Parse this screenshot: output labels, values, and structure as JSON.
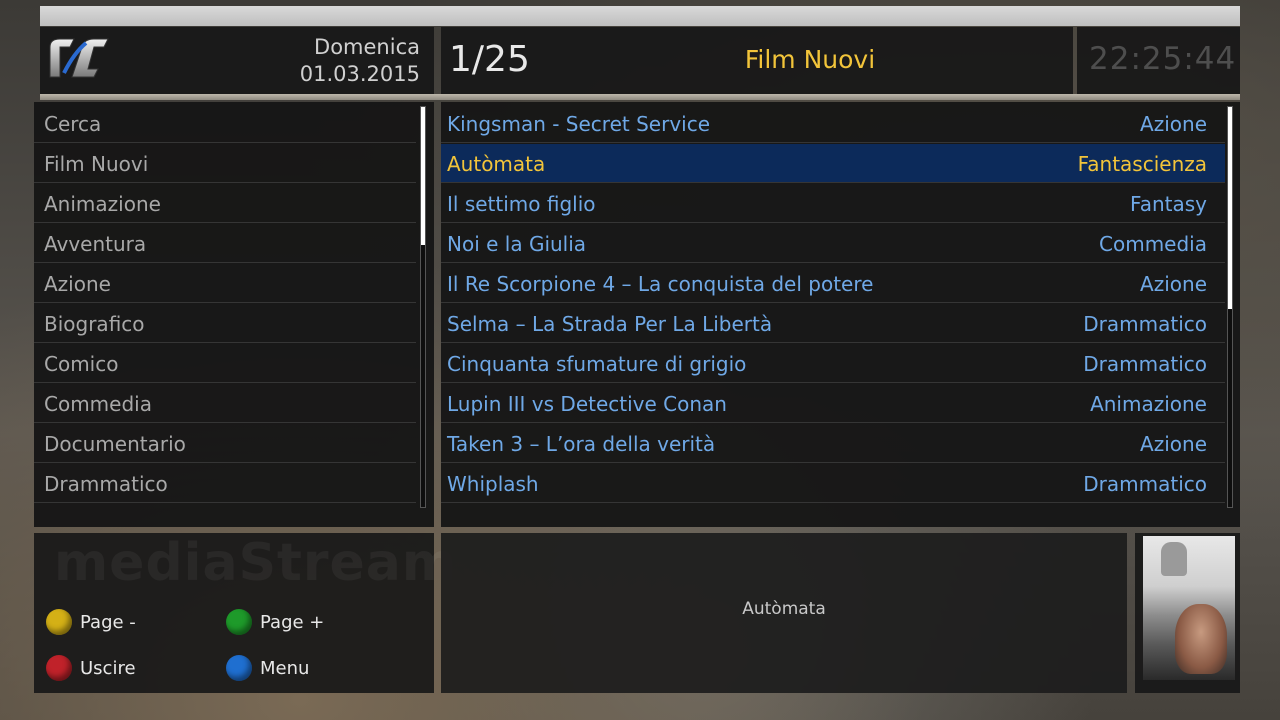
{
  "header": {
    "day": "Domenica",
    "date": "01.03.2015",
    "counter": "1/25",
    "title": "Film Nuovi",
    "clock": "22:25:44"
  },
  "categories": [
    {
      "label": "Cerca"
    },
    {
      "label": "Film Nuovi"
    },
    {
      "label": "Animazione"
    },
    {
      "label": "Avventura"
    },
    {
      "label": "Azione"
    },
    {
      "label": "Biografico"
    },
    {
      "label": "Comico"
    },
    {
      "label": "Commedia"
    },
    {
      "label": "Documentario"
    },
    {
      "label": "Drammatico"
    }
  ],
  "films": [
    {
      "title": "Kingsman - Secret Service",
      "genre": "Azione"
    },
    {
      "title": "Autòmata",
      "genre": "Fantascienza",
      "selected": true
    },
    {
      "title": "Il settimo figlio",
      "genre": "Fantasy"
    },
    {
      "title": "Noi e la Giulia",
      "genre": "Commedia"
    },
    {
      "title": "Il Re Scorpione 4 – La conquista del potere",
      "genre": "Azione"
    },
    {
      "title": "Selma – La Strada Per La Libertà",
      "genre": "Drammatico"
    },
    {
      "title": "Cinquanta sfumature di grigio",
      "genre": "Drammatico"
    },
    {
      "title": "Lupin III vs Detective Conan",
      "genre": "Animazione"
    },
    {
      "title": "Taken 3 – L’ora della verità",
      "genre": "Azione"
    },
    {
      "title": "Whiplash",
      "genre": "Drammatico"
    }
  ],
  "buttons": {
    "yellow": {
      "label": "Page -",
      "color": "#d4b016"
    },
    "green": {
      "label": "Page +",
      "color": "#1e9a2a"
    },
    "red": {
      "label": "Uscire",
      "color": "#c0222a"
    },
    "blue": {
      "label": "Menu",
      "color": "#1f6fd0"
    }
  },
  "watermark": "mediaStream",
  "description": "Autòmata",
  "colors": {
    "accent": "#f2c43a",
    "link": "#6fa8e6",
    "selected_bg": "#0c2a5a"
  }
}
